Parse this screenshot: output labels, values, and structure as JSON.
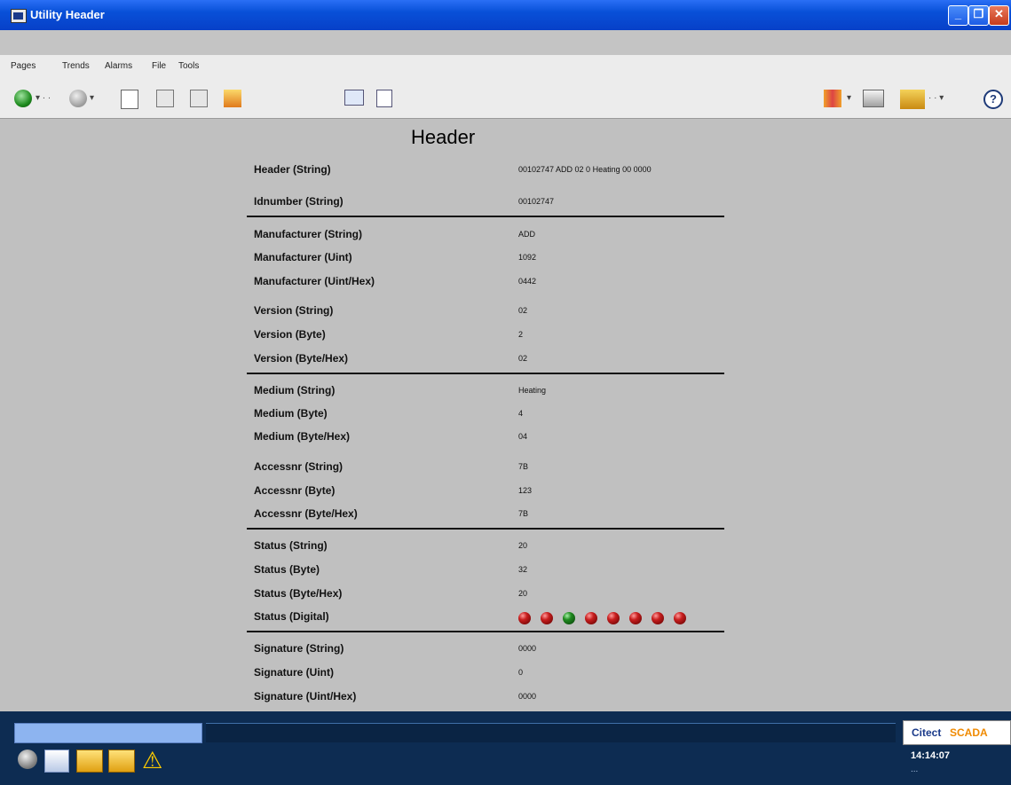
{
  "window": {
    "title": "Utility Header"
  },
  "menu": {
    "items": [
      "Pages",
      "Trends",
      "Alarms",
      "File",
      "Tools"
    ]
  },
  "page": {
    "title": "Header"
  },
  "fields": {
    "header_string": {
      "label": "Header (String)",
      "value": "00102747 ADD 02 0 Heating 00 0000"
    },
    "idnumber_string": {
      "label": "Idnumber (String)",
      "value": "00102747"
    },
    "manufacturer_string": {
      "label": "Manufacturer (String)",
      "value": "ADD"
    },
    "manufacturer_uint": {
      "label": "Manufacturer (Uint)",
      "value": "1092"
    },
    "manufacturer_uinthex": {
      "label": "Manufacturer (Uint/Hex)",
      "value": "0442"
    },
    "version_string": {
      "label": "Version (String)",
      "value": "02"
    },
    "version_byte": {
      "label": "Version (Byte)",
      "value": "2"
    },
    "version_bytehex": {
      "label": "Version (Byte/Hex)",
      "value": "02"
    },
    "medium_string": {
      "label": "Medium (String)",
      "value": "Heating"
    },
    "medium_byte": {
      "label": "Medium (Byte)",
      "value": "4"
    },
    "medium_bytehex": {
      "label": "Medium (Byte/Hex)",
      "value": "04"
    },
    "accessnr_string": {
      "label": "Accessnr (String)",
      "value": "7B"
    },
    "accessnr_byte": {
      "label": "Accessnr (Byte)",
      "value": "123"
    },
    "accessnr_bytehex": {
      "label": "Accessnr (Byte/Hex)",
      "value": "7B"
    },
    "status_string": {
      "label": "Status (String)",
      "value": "20"
    },
    "status_byte": {
      "label": "Status (Byte)",
      "value": "32"
    },
    "status_bytehex": {
      "label": "Status (Byte/Hex)",
      "value": "20"
    },
    "status_digital": {
      "label": "Status (Digital)",
      "bits": [
        0,
        0,
        1,
        0,
        0,
        0,
        0,
        0
      ],
      "on_color": "#1f8a1f",
      "off_color": "#c81e1e"
    },
    "signature_string": {
      "label": "Signature (String)",
      "value": "0000"
    },
    "signature_uint": {
      "label": "Signature (Uint)",
      "value": "0"
    },
    "signature_uinthex": {
      "label": "Signature (Uint/Hex)",
      "value": "0000"
    }
  },
  "footer": {
    "brand_prefix": "Citect",
    "brand_suffix": "SCADA",
    "time": "14:14:07",
    "date": "..."
  },
  "colors": {
    "titlebar": "#0850d8",
    "content_bg": "#c0c0c0",
    "taskbar": "#0d2c52",
    "brand_orange": "#f08a00"
  }
}
